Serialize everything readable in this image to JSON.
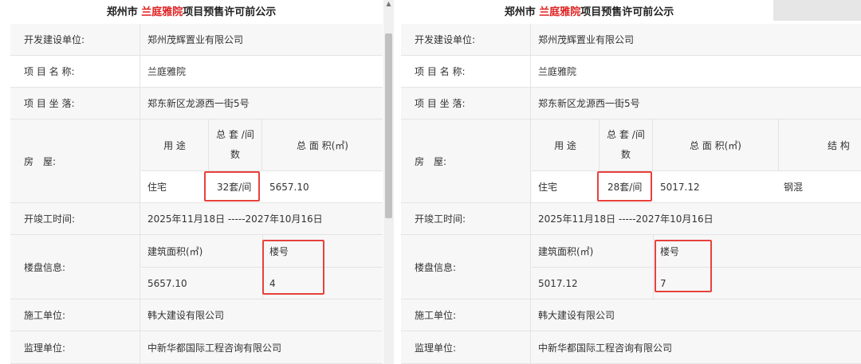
{
  "left": {
    "title_prefix": "郑州市 ",
    "title_highlight": "兰庭雅院",
    "title_suffix": "项目预售许可前公示",
    "developer_label": "开发建设单位:",
    "developer_value": "郑州茂辉置业有限公司",
    "project_name_label": "项 目 名 称:",
    "project_name_value": "兰庭雅院",
    "location_label": "项 目 坐 落:",
    "location_value": "郑东新区龙源西一街5号",
    "house_label": "房　屋:",
    "house_header_usage": "用 途",
    "house_header_units_line1": "总 套 /间",
    "house_header_units_line2": "数",
    "house_header_area": "总 面 积(㎡)",
    "house_usage": "住宅",
    "house_units": "32套/间",
    "house_area": "5657.10",
    "construction_time_label": "开竣工时间:",
    "construction_time_value": "2025年11月18日 -----2027年10月16日",
    "building_label": "楼盘信息:",
    "building_area_header": "建筑面积(㎡)",
    "building_no_header": "楼号",
    "building_area_value": "5657.10",
    "building_no_value": "4",
    "contractor_label": "施工单位:",
    "contractor_value": "韩大建设有限公司",
    "supervisor_label": "监理单位:",
    "supervisor_value": "中新华都国际工程咨询有限公司"
  },
  "right": {
    "title_prefix": "郑州市 ",
    "title_highlight": "兰庭雅院",
    "title_suffix": "项目预售许可前公示",
    "developer_label": "开发建设单位:",
    "developer_value": "郑州茂辉置业有限公司",
    "project_name_label": "项 目 名 称:",
    "project_name_value": "兰庭雅院",
    "location_label": "项 目 坐 落:",
    "location_value": "郑东新区龙源西一街5号",
    "house_label": "房　屋:",
    "house_header_usage": "用 途",
    "house_header_units_line1": "总 套 /间",
    "house_header_units_line2": "数",
    "house_header_area": "总 面 积(㎡)",
    "house_header_structure": "结 构",
    "house_usage": "住宅",
    "house_units": "28套/间",
    "house_area": "5017.12",
    "house_structure": "钢混",
    "construction_time_label": "开竣工时间:",
    "construction_time_value": "2025年11月18日 -----2027年10月16日",
    "building_label": "楼盘信息:",
    "building_area_header": "建筑面积(㎡)",
    "building_no_header": "楼号",
    "building_area_value": "5017.12",
    "building_no_value": "7",
    "contractor_label": "施工单位:",
    "contractor_value": "韩大建设有限公司",
    "supervisor_label": "监理单位:",
    "supervisor_value": "中新华都国际工程咨询有限公司"
  },
  "colors": {
    "highlight_red": "#e02020",
    "annotation_box": "#e8413c",
    "row_gray": "#f7f7f7",
    "border": "#e4e4e4"
  },
  "icons": {
    "scroll_up": "chevron-up-icon"
  }
}
